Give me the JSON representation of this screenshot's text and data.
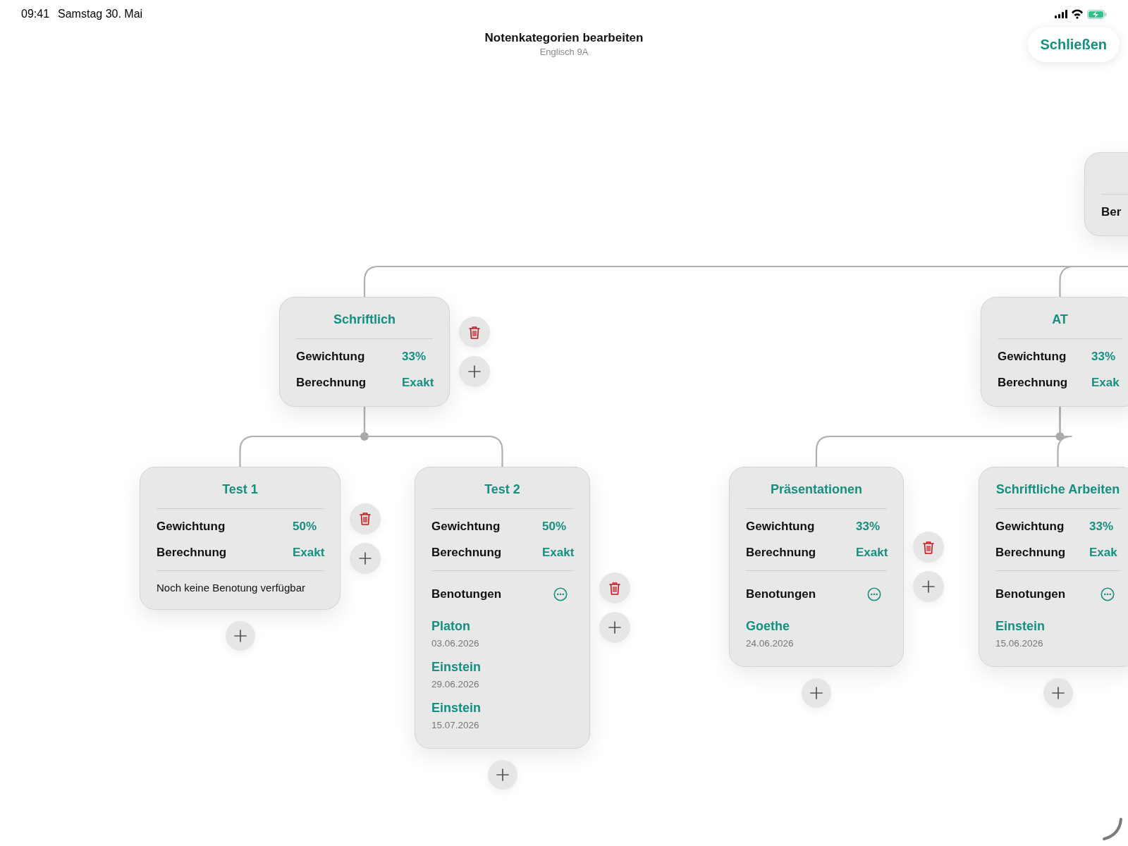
{
  "status_bar": {
    "time": "09:41",
    "date": "Samstag 30. Mai"
  },
  "header": {
    "title": "Notenkategorien bearbeiten",
    "subtitle": "Englisch 9A",
    "close_button": "Schließen"
  },
  "tree": {
    "rows": [
      {
        "label": "Ber"
      }
    ],
    "children": [
      {
        "title": "Schriftlich",
        "rows": [
          {
            "label": "Gewichtung",
            "value": "33%"
          },
          {
            "label": "Berechnung",
            "value": "Exakt"
          }
        ],
        "actions": [
          {
            "kind": "delete"
          },
          {
            "kind": "add"
          }
        ],
        "children": [
          {
            "title": "Test 1",
            "rows": [
              {
                "label": "Gewichtung",
                "value": "50%"
              },
              {
                "label": "Berechnung",
                "value": "Exakt"
              }
            ],
            "note": "Noch keine Benotung verfügbar",
            "actions": [
              {
                "kind": "delete"
              },
              {
                "kind": "add"
              },
              {
                "kind": "add_below"
              }
            ]
          },
          {
            "title": "Test 2",
            "rows": [
              {
                "label": "Gewichtung",
                "value": "50%"
              },
              {
                "label": "Berechnung",
                "value": "Exakt"
              }
            ],
            "grades_heading": "Benotungen",
            "grades": [
              {
                "name": "Platon",
                "date": "03.06.2026"
              },
              {
                "name": "Einstein",
                "date": "29.06.2026"
              },
              {
                "name": "Einstein",
                "date": "15.07.2026"
              }
            ],
            "actions": [
              {
                "kind": "delete"
              },
              {
                "kind": "add"
              },
              {
                "kind": "add_below"
              }
            ]
          }
        ]
      },
      {
        "title": "AT",
        "rows": [
          {
            "label": "Gewichtung",
            "value": "33%"
          },
          {
            "label": "Berechnung",
            "value": "Exak"
          }
        ],
        "children": [
          {
            "title": "Präsentationen",
            "rows": [
              {
                "label": "Gewichtung",
                "value": "33%"
              },
              {
                "label": "Berechnung",
                "value": "Exakt"
              }
            ],
            "grades_heading": "Benotungen",
            "grades": [
              {
                "name": "Goethe",
                "date": "24.06.2026"
              }
            ],
            "actions": [
              {
                "kind": "delete"
              },
              {
                "kind": "add"
              },
              {
                "kind": "add_below"
              }
            ]
          },
          {
            "title": "Schriftliche Arbeiten",
            "rows": [
              {
                "label": "Gewichtung",
                "value": "33%"
              },
              {
                "label": "Berechnung",
                "value": "Exak"
              }
            ],
            "grades_heading": "Benotungen",
            "grades": [
              {
                "name": "Einstein",
                "date": "15.06.2026"
              }
            ],
            "actions": [
              {
                "kind": "add_below"
              }
            ]
          }
        ]
      }
    ]
  }
}
